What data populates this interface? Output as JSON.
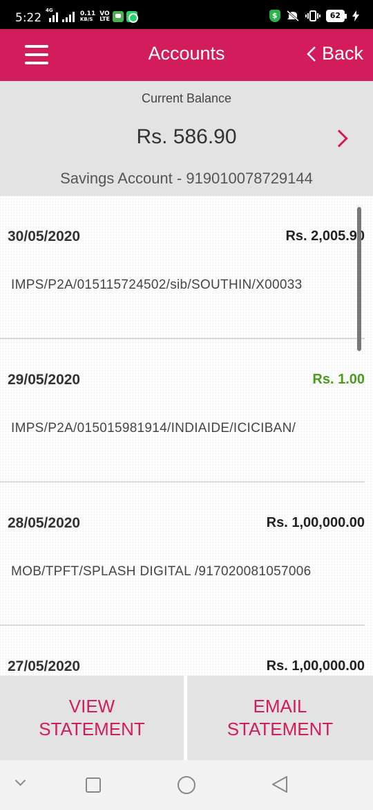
{
  "status_bar": {
    "time": "5:22",
    "network_label": "4G",
    "speed_value": "0.11",
    "speed_unit": "KB/S",
    "volte_top": "VO",
    "volte_bottom": "LTE",
    "battery": "62",
    "icons": [
      "signal-icon",
      "chat-icon",
      "whatsapp-icon",
      "security-shield-icon",
      "mute-icon",
      "vibrate-icon",
      "battery-icon",
      "charging-icon"
    ]
  },
  "header": {
    "title": "Accounts",
    "back_label": "Back",
    "background_color": "#d21c5c"
  },
  "balance": {
    "label": "Current Balance",
    "amount": "Rs. 586.90",
    "account": "Savings Account - 919010078729144"
  },
  "transactions": [
    {
      "date": "30/05/2020",
      "amount": "Rs. 2,005.90",
      "type": "debit",
      "description": "IMPS/P2A/015115724502/sib/SOUTHIN/X00033"
    },
    {
      "date": "29/05/2020",
      "amount": "Rs. 1.00",
      "type": "credit",
      "description": "IMPS/P2A/015015981914/INDIAIDE/ICICIBAN/"
    },
    {
      "date": "28/05/2020",
      "amount": "Rs. 1,00,000.00",
      "type": "debit",
      "description": "MOB/TPFT/SPLASH DIGITAL /917020081057006"
    },
    {
      "date": "27/05/2020",
      "amount": "Rs. 1,00,000.00",
      "type": "debit",
      "description": ""
    }
  ],
  "actions": {
    "view_statement_line1": "VIEW",
    "view_statement_line2": "STATEMENT",
    "email_statement_line1": "EMAIL",
    "email_statement_line2": "STATEMENT"
  },
  "colors": {
    "accent": "#d21c5c",
    "credit": "#4a9a1e",
    "panel": "#e3e3e3"
  }
}
